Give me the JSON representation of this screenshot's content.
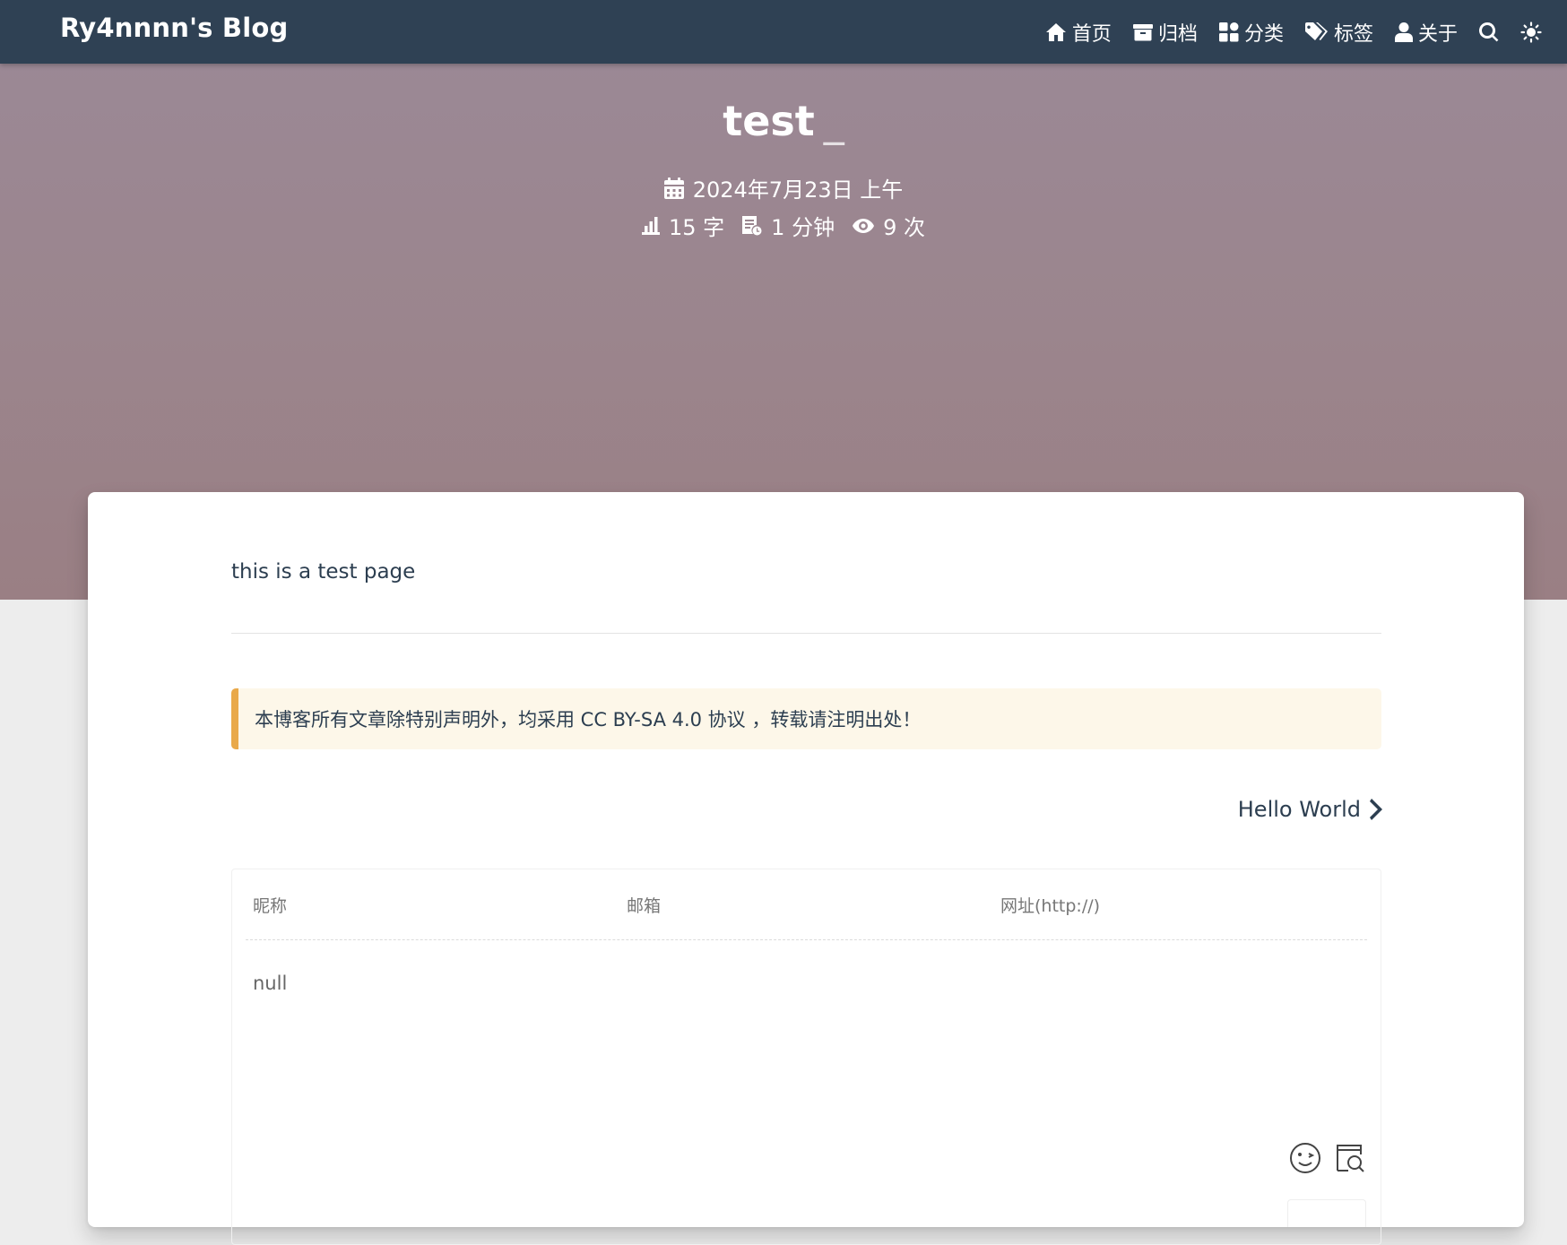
{
  "navbar": {
    "brand": "Ry4nnnn's Blog",
    "items": [
      {
        "label": "首页",
        "icon": "home-icon"
      },
      {
        "label": "归档",
        "icon": "archive-icon"
      },
      {
        "label": "分类",
        "icon": "category-icon"
      },
      {
        "label": "标签",
        "icon": "tags-icon"
      },
      {
        "label": "关于",
        "icon": "user-icon"
      }
    ],
    "search_icon": "search-icon",
    "theme_icon": "sun-icon"
  },
  "post": {
    "title": "test",
    "cursor": "_",
    "date": "2024年7月23日 上午",
    "word_count": "15 字",
    "read_time": "1 分钟",
    "views": "9 次",
    "content": "this is a test page"
  },
  "notice": "本博客所有文章除特别声明外，均采用 CC BY-SA 4.0 协议 ，转载请注明出处！",
  "next_post": "Hello World",
  "comment": {
    "nickname_placeholder": "昵称",
    "email_placeholder": "邮箱",
    "url_placeholder": "网址(http://)",
    "textarea_value": "null",
    "emoji_icon": "emoji-icon",
    "preview_icon": "preview-icon"
  },
  "colors": {
    "navbar_bg": "#2f4154",
    "banner_bg": "#9b858d",
    "notice_accent": "#e9a94a",
    "notice_bg": "#fdf7e9"
  }
}
